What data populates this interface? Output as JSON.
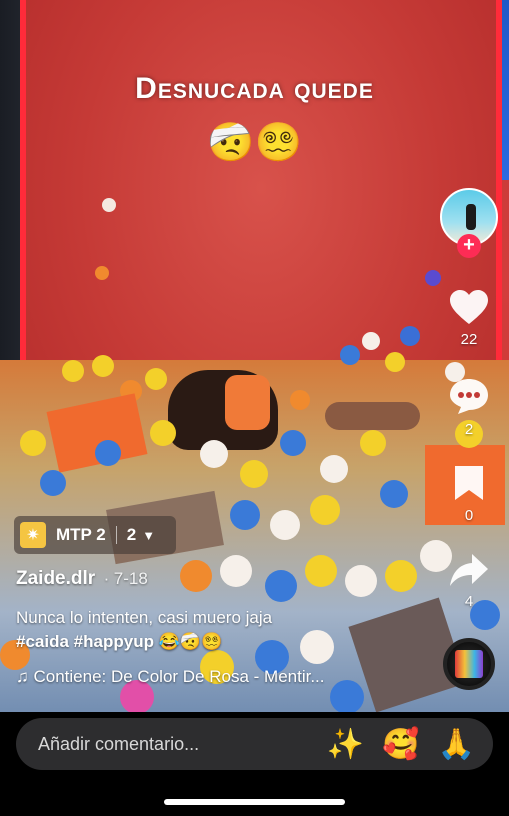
{
  "video": {
    "overlay_title": "Desnucada quede",
    "overlay_emojis": "🤕😵‍💫"
  },
  "rail": {
    "avatar": "avatar-profile",
    "follow_icon": "plus-icon",
    "like_icon": "heart-icon",
    "likes": "22",
    "comment_icon": "comment-icon",
    "comments": "2",
    "save_icon": "bookmark-icon",
    "saves": "0",
    "share_icon": "share-icon",
    "shares": "4"
  },
  "sound_pill": {
    "icon": "spark-icon",
    "name": "MTP 2",
    "count": "2",
    "chevron": "chevron-down-icon"
  },
  "post": {
    "author": "Zaide.dlr",
    "separator": "·",
    "date": "7-18",
    "description_line1": "Nunca lo intenten, casi muero jaja",
    "hashtag1": "#caida",
    "hashtag2": "#happyup",
    "description_emojis": "😂🤕😵‍💫",
    "music_icon": "music-note-icon",
    "music_text": "Contiene: De Color De Rosa - Mentir..."
  },
  "comment_bar": {
    "placeholder": "Añadir comentario...",
    "quick_reactions": [
      "✨",
      "🥰",
      "🙏"
    ]
  },
  "colors": {
    "accent": "#fe2c55",
    "slide_red": "#c53a36",
    "bar_bg": "#2d2d2f"
  }
}
